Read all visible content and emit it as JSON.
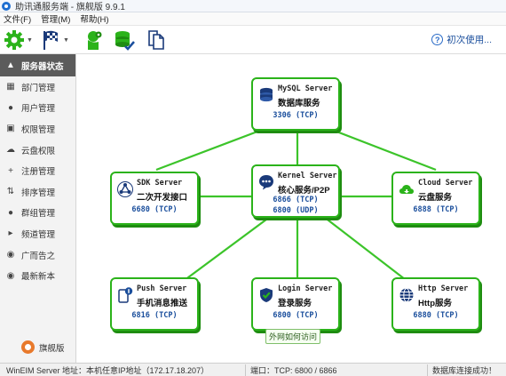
{
  "window": {
    "title": "助讯通服务端 - 旗舰版  9.9.1"
  },
  "menubar": {
    "items": [
      "文件(F)",
      "管理(M)",
      "帮助(H)"
    ]
  },
  "toolbar": {
    "help_label": "初次使用..."
  },
  "sidebar": {
    "items": [
      {
        "label": "服务器状态",
        "icon": "server-status-icon"
      },
      {
        "label": "部门管理",
        "icon": "department-icon"
      },
      {
        "label": "用户管理",
        "icon": "user-icon"
      },
      {
        "label": "权限管理",
        "icon": "lock-icon"
      },
      {
        "label": "云盘权限",
        "icon": "cloud-icon"
      },
      {
        "label": "注册管理",
        "icon": "plus-icon"
      },
      {
        "label": "排序管理",
        "icon": "sort-icon"
      },
      {
        "label": "群组管理",
        "icon": "group-icon"
      },
      {
        "label": "频道管理",
        "icon": "channel-icon"
      },
      {
        "label": "广而告之",
        "icon": "location-icon"
      },
      {
        "label": "最新新本",
        "icon": "latest-version-icon"
      }
    ],
    "edition_label": "旗舰版"
  },
  "servers": {
    "mysql": {
      "name": "MySQL Server",
      "desc": "数据库服务",
      "port1": "3306  (TCP)"
    },
    "sdk": {
      "name": "SDK Server",
      "desc": "二次开发接口",
      "port1": "6680  (TCP)"
    },
    "kernel": {
      "name": "Kernel Server",
      "desc": "核心服务/P2P",
      "port1": "6866  (TCP)",
      "port2": "6800  (UDP)"
    },
    "cloud": {
      "name": "Cloud Server",
      "desc": "云盘服务",
      "port1": "6888  (TCP)"
    },
    "push": {
      "name": "Push Server",
      "desc": "手机消息推送",
      "port1": "6816  (TCP)"
    },
    "login": {
      "name": "Login Server",
      "desc": "登录服务",
      "port1": "6800  (TCP)"
    },
    "http": {
      "name": "Http Server",
      "desc": "Http服务",
      "port1": "6880  (TCP)"
    }
  },
  "external_access_label": "外网如何访问",
  "statusbar": {
    "address": "WinEIM Server 地址：本机任意IP地址（172.17.18.207）",
    "ports": "端口：TCP: 6800 / 6866",
    "status": "数据库连接成功！"
  },
  "colors": {
    "accent_green": "#2bb31a",
    "link_green": "#3cc42a",
    "port_blue": "#1a4e9c"
  }
}
